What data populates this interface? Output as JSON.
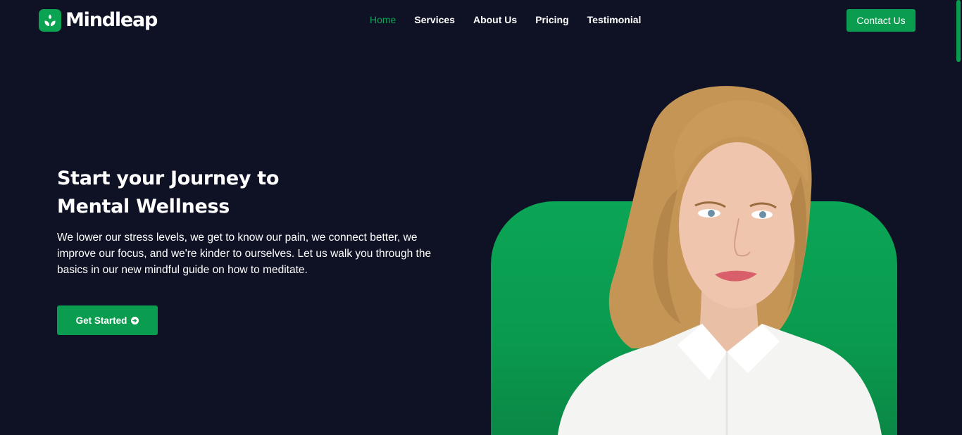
{
  "header": {
    "brand": "Mindleap",
    "nav": [
      {
        "label": "Home",
        "active": true
      },
      {
        "label": "Services",
        "active": false
      },
      {
        "label": "About Us",
        "active": false
      },
      {
        "label": "Pricing",
        "active": false
      },
      {
        "label": "Testimonial",
        "active": false
      }
    ],
    "contact_label": "Contact Us"
  },
  "hero": {
    "title_line1": "Start your Journey to",
    "title_line2": "Mental Wellness",
    "description": "We lower our stress levels, we get to know our pain, we connect better, we improve our focus, and we're kinder to ourselves. Let us walk you through the basics in our new mindful guide on how to meditate.",
    "cta_label": "Get Started",
    "cta_icon": "arrow-right-circle-icon"
  },
  "colors": {
    "background": "#0f1225",
    "accent": "#0a9d4f",
    "active_nav": "#13a156"
  }
}
